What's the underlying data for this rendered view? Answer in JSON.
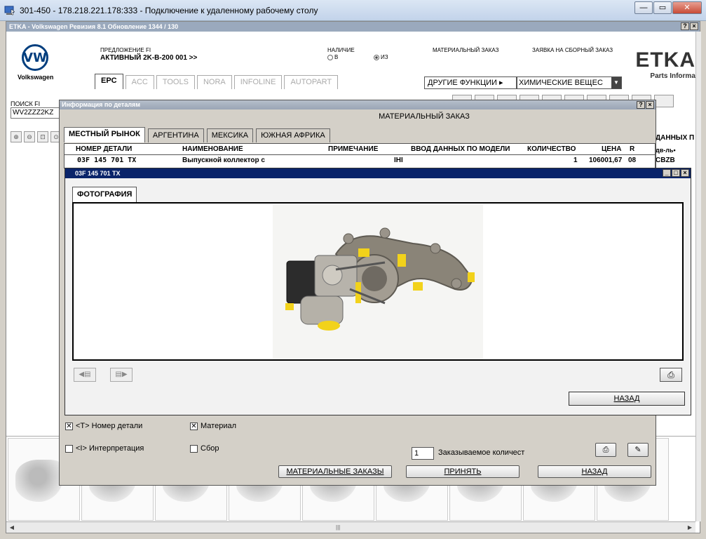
{
  "rdp": {
    "title": "301-450 - 178.218.221.178:333 - Подключение к удаленному рабочему столу",
    "minimize": "—",
    "maximize": "▭",
    "close": "✕"
  },
  "etka": {
    "title": "ETKA - Volkswagen Ревизия 8.1 Обновление 1344 / 130",
    "help": "?",
    "close": "×",
    "brand": "Volkswagen",
    "logo_letter": "VW",
    "etka_logo": "ETKA",
    "etka_sub": "Parts Informati",
    "proposal_label": "ПРЕДЛОЖЕНИЕ FI",
    "proposal_value": "АКТИВНЫЙ  2K-B-200 001 >>",
    "availability_label": "НАЛИЧИЕ",
    "availability_in": "В",
    "availability_from": "ИЗ",
    "material_order_label": "МАТЕРИАЛЬНЫЙ ЗАКАЗ",
    "assembly_order_label": "ЗАЯВКА НА СБОРНЫЙ ЗАКАЗ",
    "tabs": [
      "EPC",
      "ACC",
      "TOOLS",
      "NORA",
      "INFOLINE",
      "AUTOPART"
    ],
    "other_functions": "ДРУГИЕ ФУНКЦИИ ▸",
    "chemicals": "ХИМИЧЕСКИЕ ВЕЩЕС",
    "search_label": "ПОИСК FI",
    "search_value": "WV2ZZZ2KZ",
    "right_frag1": "ДАННЫХ П",
    "right_frag2": "дв-ль•",
    "right_frag3": "CBZB"
  },
  "dialog": {
    "title": "Информация по деталям",
    "help": "?",
    "close": "×",
    "header": "МАТЕРИАЛЬНЫЙ ЗАКАЗ",
    "tabs": [
      "МЕСТНЫЙ РЫНОК",
      "АРГЕНТИНА",
      "МЕКСИКА",
      "ЮЖНАЯ АФРИКА"
    ],
    "columns": {
      "part_no": "НОМЕР ДЕТАЛИ",
      "name": "НАИМЕНОВАНИЕ",
      "note": "ПРИМЕЧАНИЕ",
      "model_data": "ВВОД ДАННЫХ ПО МОДЕЛИ",
      "qty": "КОЛИЧЕСТВО",
      "price": "ЦЕНА",
      "r": "R"
    },
    "row": {
      "part_no": "03F 145 701 TX",
      "name": "Выпускной коллектор с",
      "note": "IHI",
      "qty": "1",
      "price": "106001,67",
      "r": "08"
    },
    "check_part_no": "<T> Номер детали",
    "check_material": "Материал",
    "check_interpretation": "<I> Интерпретация",
    "check_assembly": "Сбор",
    "check_mark": "✕",
    "order_qty": "1",
    "order_qty_label": "Заказываемое количест",
    "btn_material_orders": "МАТЕРИАЛЬНЫЕ ЗАКАЗЫ",
    "btn_accept": "ПРИНЯТЬ",
    "btn_back": "НАЗАД"
  },
  "photo": {
    "title": "03F 145 701 TX",
    "tab": "ФОТОГРАФИЯ",
    "btn_back": "НАЗАД",
    "minimize": "_",
    "maximize": "□",
    "close": "×"
  }
}
